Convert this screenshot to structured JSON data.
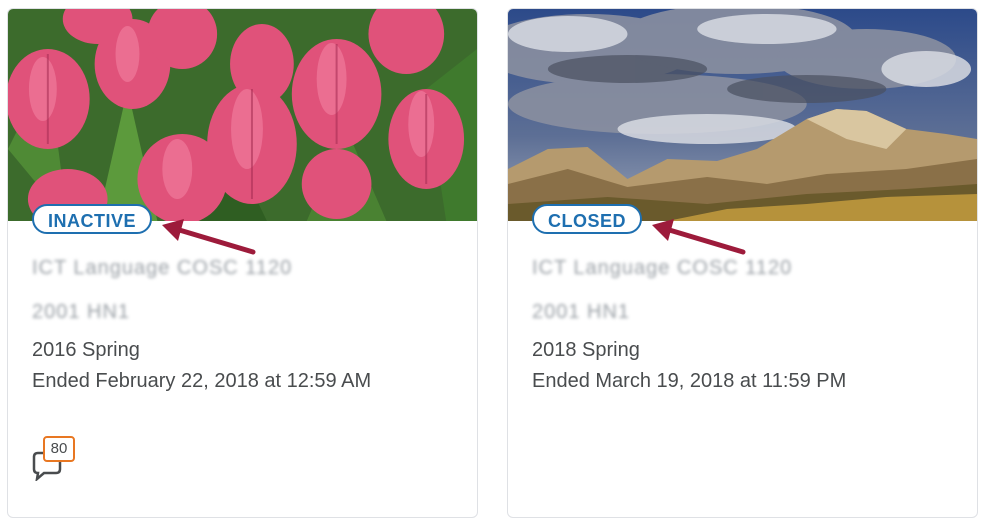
{
  "courses": [
    {
      "status": "INACTIVE",
      "title_line1": "ICT Language COSC 1120",
      "title_line2": "2001 HN1",
      "semester": "2016 Spring",
      "ended": "Ended February 22, 2018 at 12:59 AM",
      "discussion_count": "80",
      "image": "pink-tulips-photo"
    },
    {
      "status": "CLOSED",
      "title_line1": "ICT Language COSC 1120",
      "title_line2": "2001 HN1",
      "semester": "2018 Spring",
      "ended": "Ended March 19, 2018 at 11:59 PM",
      "image": "mountain-landscape-photo"
    }
  ],
  "colors": {
    "badge_blue": "#1e6fb0",
    "arrow_red": "#9d1b3b",
    "count_badge_orange": "#e87722",
    "text": "#494c4e"
  },
  "icons": {
    "discussion": "speech-bubble-icon",
    "annotation": "red-arrow-annotation"
  }
}
